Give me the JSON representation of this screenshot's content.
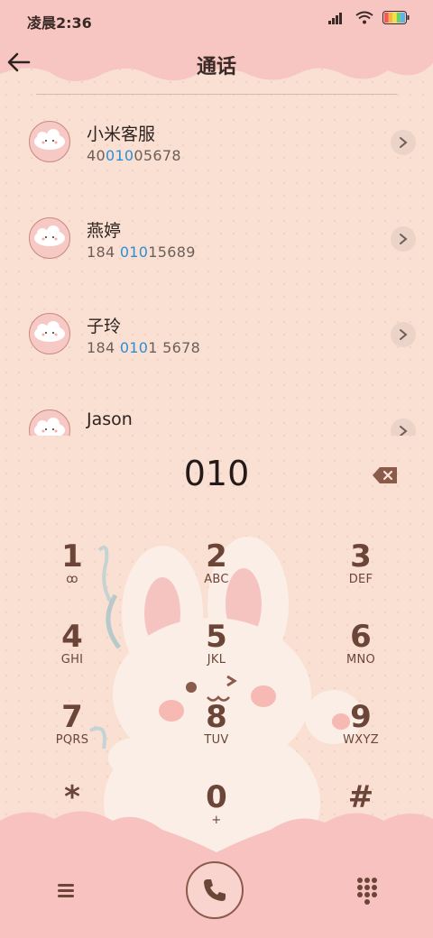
{
  "status": {
    "time": "凌晨2:36"
  },
  "header": {
    "title": "通话",
    "back_icon": "arrow-left-icon"
  },
  "contacts": [
    {
      "name": "小米客服",
      "num_pre": "40",
      "num_hl": "010",
      "num_post": "05678"
    },
    {
      "name": "燕婷",
      "num_pre": "184 ",
      "num_hl": "010",
      "num_post": "15689"
    },
    {
      "name": "子玲",
      "num_pre": "184 ",
      "num_hl": "010",
      "num_post": "1 5678"
    },
    {
      "name": "Jason",
      "num_pre": "",
      "num_hl": "",
      "num_post": ""
    }
  ],
  "dial": {
    "number": "010"
  },
  "keys": [
    {
      "digit": "1",
      "letters": "ꝏ"
    },
    {
      "digit": "2",
      "letters": "ABC"
    },
    {
      "digit": "3",
      "letters": "DEF"
    },
    {
      "digit": "4",
      "letters": "GHI"
    },
    {
      "digit": "5",
      "letters": "JKL"
    },
    {
      "digit": "6",
      "letters": "MNO"
    },
    {
      "digit": "7",
      "letters": "PQRS"
    },
    {
      "digit": "8",
      "letters": "TUV"
    },
    {
      "digit": "9",
      "letters": "WXYZ"
    },
    {
      "digit": "*",
      "letters": ","
    },
    {
      "digit": "0",
      "letters": "+"
    },
    {
      "digit": "#",
      "letters": ""
    }
  ],
  "colors": {
    "accent_blue": "#2a8fd6",
    "key_brown": "#6b4537",
    "cloud_pink": "#f7c2c0"
  }
}
